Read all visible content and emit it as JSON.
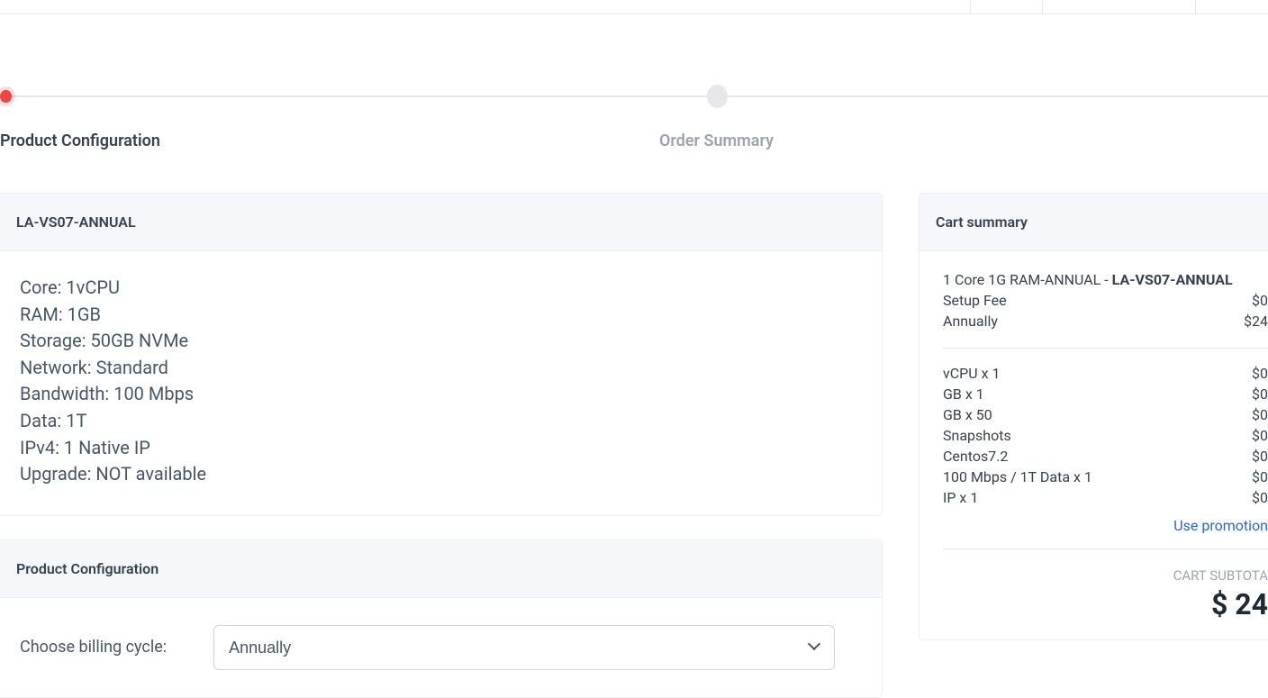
{
  "steps": {
    "active_label": "Product Configuration",
    "inactive_label": "Order Summary"
  },
  "product": {
    "title": "LA-VS07-ANNUAL",
    "specs": [
      "Core: 1vCPU",
      "RAM: 1GB",
      "Storage: 50GB NVMe",
      "Network: Standard",
      "Bandwidth: 100 Mbps",
      "Data: 1T",
      "IPv4: 1 Native IP",
      "Upgrade: NOT available"
    ]
  },
  "config": {
    "header": "Product Configuration",
    "billing_label": "Choose billing cycle:",
    "billing_selected": "Annually"
  },
  "cart": {
    "header": "Cart summary",
    "item_prefix": "1 Core 1G RAM-ANNUAL - ",
    "item_bold": "LA-VS07-ANNUAL",
    "fees": [
      {
        "label": "Setup Fee",
        "value": "$0"
      },
      {
        "label": "Annually",
        "value": "$24"
      }
    ],
    "items": [
      {
        "label": "vCPU x 1",
        "value": "$0"
      },
      {
        "label": "GB x 1",
        "value": "$0"
      },
      {
        "label": "GB x 50",
        "value": "$0"
      },
      {
        "label": "Snapshots",
        "value": "$0"
      },
      {
        "label": "Centos7.2",
        "value": "$0"
      },
      {
        "label": "100 Mbps / 1T Data x 1",
        "value": "$0"
      },
      {
        "label": "IP x 1",
        "value": "$0"
      }
    ],
    "promo_text": "Use promotion",
    "subtotal_label": "CART SUBTOTA",
    "subtotal_value": "$ 24"
  }
}
